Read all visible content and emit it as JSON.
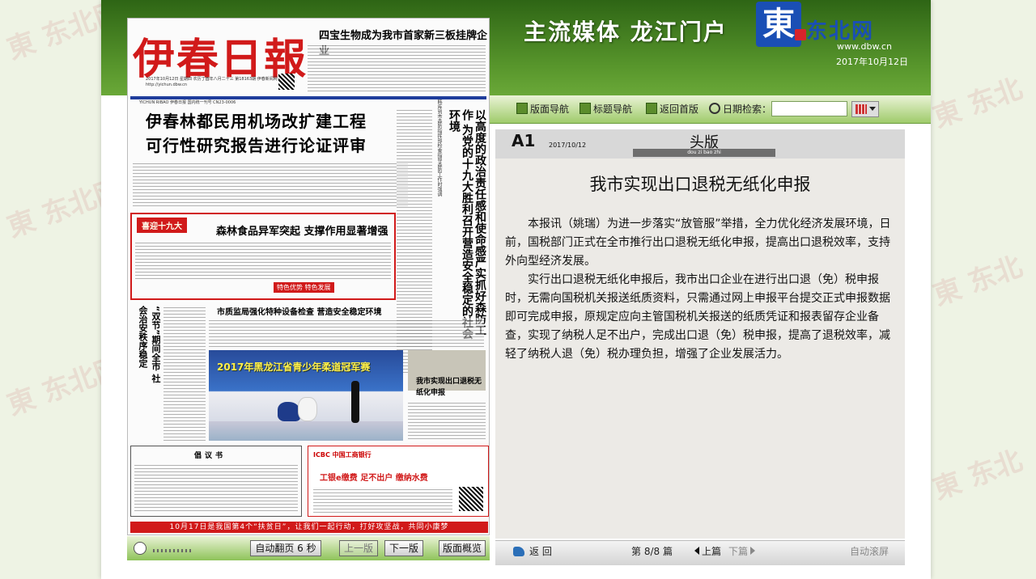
{
  "header": {
    "slogan": "主流媒体 龙江门户",
    "logo_char": "東",
    "logo_name": "东北网",
    "logo_url": "www.dbw.cn",
    "date": "2017年10月12日"
  },
  "nav": {
    "items": [
      "版面导航",
      "标题导航",
      "返回首版"
    ],
    "search_label": "日期检索：",
    "date_value": ""
  },
  "newspaper": {
    "masthead": "伊春日報",
    "mast_info": "2017年10月12日 星期四 农历丁酉年八月二十三 第18163期 伊春新闻网 http://yichun.dbw.cn",
    "top_headline": "四宝生物成为我市首家新三板挂牌企业",
    "rule_text": "YICHUN RIBAO 伊春日报 国内统一刊号 CN23-0006",
    "lead_title_1": "伊春林都民用机场改扩建工程",
    "lead_title_2": "可行性研究报告进行论证评审",
    "vertical_head": "以高度的政治责任感和使命感严实抓好森防工作 为党的十九大胜利召开营造安全稳定的社会环境",
    "vertical_sub": "韩库到市森防指挥部检查指导森防工作时强调",
    "red_tag": "喜迎十九大",
    "red_headline": "森林食品异军突起 支撑作用显著增强",
    "red_foot": "特色优势 特色发展",
    "side_vertical": "“双节”期间全市 社会治安秩序稳定",
    "mid_headline": "市质监局强化特种设备检查 营造安全稳定环境",
    "photo_title": "2017年黑龙江省青少年柔道冠军赛",
    "sub_headline": "我市实现出口退税无纸化申报",
    "proposal_title": "倡议书",
    "bank_name": "ICBC 中国工商银行",
    "bank_slogan": "工银e缴费 足不出户 缴纳水费",
    "banner": "10月17日是我国第4个“扶贫日”，让我们一起行动，打好攻坚战，共同小康梦"
  },
  "bottom_bar": {
    "auto_page": "自动翻页 6 秒",
    "prev": "上一版",
    "next": "下一版",
    "overview": "版面概览"
  },
  "reader": {
    "page_code": "A1",
    "page_date": "2017/10/12",
    "page_name": "头版",
    "page_pinyin": "dou zi bao zhi",
    "article_title": "我市实现出口退税无纸化申报",
    "paragraphs": [
      "本报讯（姚瑞）为进一步落实“放管服”举措，全力优化经济发展环境，日前，国税部门正式在全市推行出口退税无纸化申报，提高出口退税效率，支持外向型经济发展。",
      "实行出口退税无纸化申报后，我市出口企业在进行出口退（免）税申报时，无需向国税机关报送纸质资料，只需通过网上申报平台提交正式申报数据即可完成申报，原规定应向主管国税机关报送的纸质凭证和报表留存企业备查，实现了纳税人足不出户，完成出口退（免）税申报，提高了退税效率，减轻了纳税人退（免）税办理负担，增强了企业发展活力。"
    ],
    "footer": {
      "back": "返 回",
      "page_counter": "第 8/8 篇",
      "prev_article": "上篇",
      "next_article": "下篇",
      "auto_scroll": "自动滚屏"
    }
  },
  "colors": {
    "header_green": "#2e6515",
    "nav_green": "#9fcb6b",
    "paper_red": "#d11a1a",
    "logo_blue": "#1a4fb5"
  }
}
